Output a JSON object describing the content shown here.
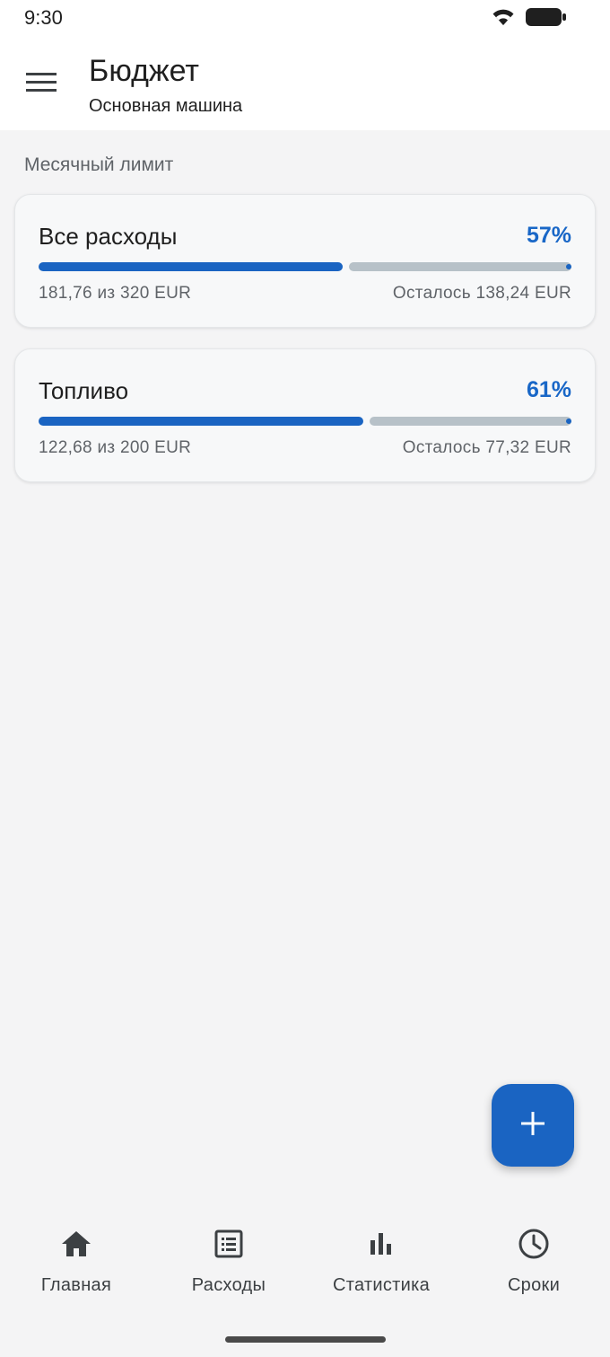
{
  "status": {
    "time": "9:30",
    "icons": [
      "wifi-icon",
      "battery-icon"
    ]
  },
  "header": {
    "menu_icon": "menu-icon",
    "title": "Бюджет",
    "subtitle": "Основная машина"
  },
  "section": {
    "label": "Месячный лимит"
  },
  "cards": [
    {
      "title": "Все расходы",
      "percent_label": "57%",
      "progress": 0.57,
      "spent_label": "181,76 из 320 EUR",
      "remaining_label": "Осталось 138,24 EUR"
    },
    {
      "title": "Топливо",
      "percent_label": "61%",
      "progress": 0.61,
      "spent_label": "122,68 из 200 EUR",
      "remaining_label": "Осталось 77,32 EUR"
    }
  ],
  "fab": {
    "icon": "plus-icon"
  },
  "nav": {
    "items": [
      {
        "label": "Главная",
        "icon": "home-icon"
      },
      {
        "label": "Расходы",
        "icon": "list-icon"
      },
      {
        "label": "Статистика",
        "icon": "bar-chart-icon"
      },
      {
        "label": "Сроки",
        "icon": "clock-icon"
      }
    ]
  },
  "colors": {
    "accent": "#1a64c2",
    "track": "#b7c1c8",
    "background": "#f4f4f5"
  }
}
